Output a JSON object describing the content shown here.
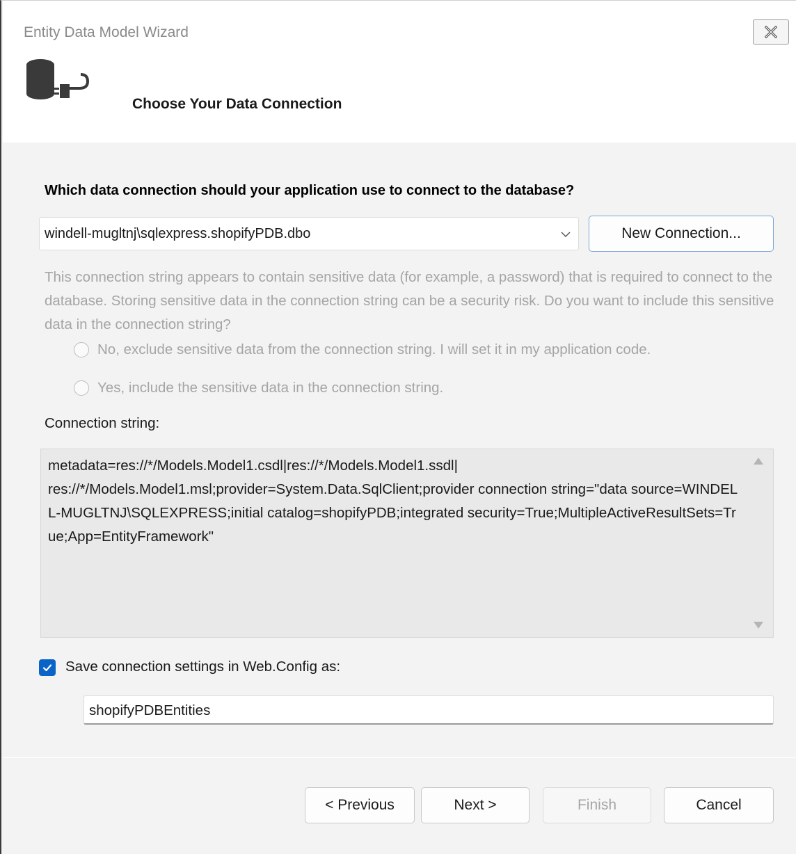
{
  "window": {
    "title": "Entity Data Model Wizard"
  },
  "header": {
    "title": "Choose Your Data Connection",
    "icon": "database-plug-icon"
  },
  "main": {
    "question": "Which data connection should your application use to connect to the database?",
    "connection_select": {
      "value": "windell-mugltnj\\sqlexpress.shopifyPDB.dbo"
    },
    "new_connection_label": "New Connection...",
    "sensitive_info": "This connection string appears to contain sensitive data (for example, a password) that is required to connect to the database. Storing sensitive data in the connection string can be a security risk. Do you want to include this sensitive data in the connection string?",
    "radio_options": [
      {
        "label": "No, exclude sensitive data from the connection string. I will set it in my application code.",
        "enabled": false,
        "selected": false
      },
      {
        "label": "Yes, include the sensitive data in the connection string.",
        "enabled": false,
        "selected": false
      }
    ],
    "connection_string_label": "Connection string:",
    "connection_string": "metadata=res://*/Models.Model1.csdl|res://*/Models.Model1.ssdl|\nres://*/Models.Model1.msl;provider=System.Data.SqlClient;provider connection string=\"data source=WINDELL-MUGLTNJ\\SQLEXPRESS;initial catalog=shopifyPDB;integrated security=True;MultipleActiveResultSets=True;App=EntityFramework\"",
    "save_settings": {
      "checked": true,
      "label": "Save connection settings in Web.Config as:"
    },
    "entity_name": "shopifyPDBEntities"
  },
  "footer": {
    "previous_label": "< Previous",
    "next_label": "Next >",
    "finish_label": "Finish",
    "cancel_label": "Cancel"
  },
  "colors": {
    "accent": "#0a64c8",
    "disabled_text": "#a5a5a5",
    "dialog_bg": "#f3f3f3"
  }
}
